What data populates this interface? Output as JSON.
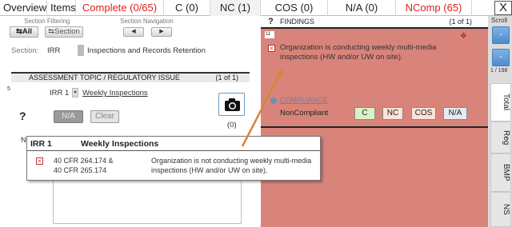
{
  "tabs": [
    {
      "label": "Overview",
      "color": "default"
    },
    {
      "label": "Items",
      "color": "default"
    },
    {
      "label": "Complete (0/65)",
      "color": "red"
    },
    {
      "label": "C (0)",
      "color": "default"
    },
    {
      "label": "NC (1)",
      "color": "default",
      "active": true
    },
    {
      "label": "COS (0)",
      "color": "default"
    },
    {
      "label": "N/A (0)",
      "color": "default"
    },
    {
      "label": "NComp (65)",
      "color": "red"
    }
  ],
  "close_label": "X",
  "filtering": {
    "caption": "Section Filtering",
    "all_label": "All",
    "section_label": "Section",
    "nav_caption": "Section Navigation",
    "prev_label": "◀",
    "next_label": "▶"
  },
  "section": {
    "label": "Section:",
    "code": "IRR",
    "name": "Inspections and Records Retention"
  },
  "assessment": {
    "header": "ASSESSMENT TOPIC / REGULATORY ISSUE",
    "count": "(1 of 1)",
    "item_number": "5",
    "item_code": "IRR 1",
    "item_title": "Weekly Inspections",
    "photo_count": "(0)",
    "na_label": "N/A",
    "clear_label": "Clear",
    "q_mark": "?",
    "notes_initial": "N"
  },
  "findings": {
    "header": "FINDINGS",
    "count": "(1 of 1)",
    "q_mark": "?",
    "number": "11",
    "text": "Organization is conducting weekly multi-media inspections (HW and/or UW on site).",
    "compliance_label": "COMPLIANCE",
    "compliance_status": "NonCompliant",
    "buttons": [
      "C",
      "NC",
      "COS",
      "N/A"
    ],
    "dots": "❖",
    "colors": {
      "background": "#d9847a",
      "c_button": "#d7f2c4",
      "nc_button": "#fbe3d6",
      "cos_button": "#fbe3d6",
      "na_button": "#e8eaf2"
    }
  },
  "sidebar": {
    "scroll_label": "Scroll",
    "up_label": "-",
    "down_label": "-",
    "count": "1 / 198",
    "tabs": [
      "Total",
      "Reg",
      "BMP",
      "NS"
    ]
  },
  "popup": {
    "code": "IRR 1",
    "title": "Weekly Inspections",
    "citation_line1": "40 CFR 264.174 &",
    "citation_line2": "40 CFR 265.174",
    "description": "Organization is not conducting weekly multi-media inspections (HW and/or UW on site)."
  }
}
